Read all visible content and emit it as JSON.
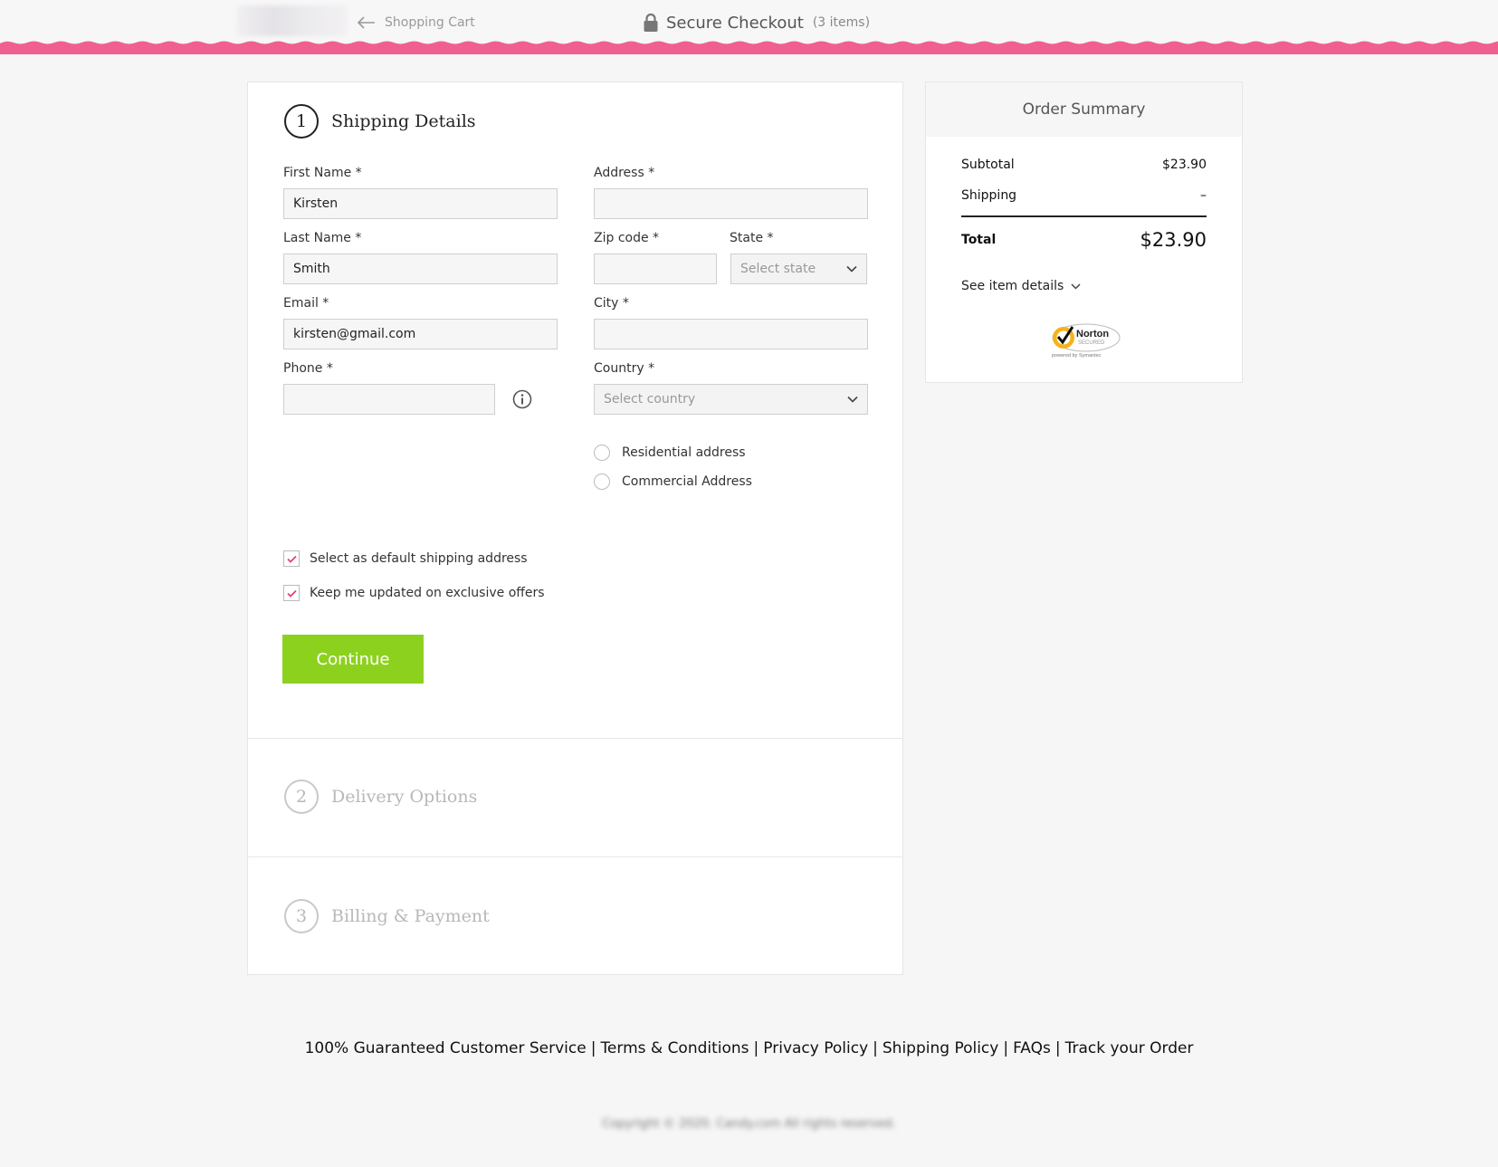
{
  "header": {
    "back_label": "Shopping Cart",
    "title": "Secure Checkout",
    "item_count": "(3 items)"
  },
  "shipping": {
    "step_number": "1",
    "title": "Shipping Details",
    "first_name": {
      "label": "First Name *",
      "value": "Kirsten"
    },
    "last_name": {
      "label": "Last Name *",
      "value": "Smith"
    },
    "email": {
      "label": "Email *",
      "value": "kirsten@gmail.com"
    },
    "phone": {
      "label": "Phone *",
      "value": ""
    },
    "address": {
      "label": "Address *",
      "value": ""
    },
    "zip": {
      "label": "Zip code *",
      "value": ""
    },
    "state": {
      "label": "State *",
      "placeholder": "Select state"
    },
    "city": {
      "label": "City *",
      "value": ""
    },
    "country": {
      "label": "Country *",
      "placeholder": "Select country"
    },
    "address_types": [
      "Residential address",
      "Commercial Address"
    ],
    "default_shipping": {
      "label": "Select as default shipping address",
      "checked": true
    },
    "offers": {
      "label": "Keep me updated on exclusive offers",
      "checked": true
    },
    "continue_label": "Continue"
  },
  "delivery": {
    "step_number": "2",
    "title": "Delivery Options"
  },
  "billing": {
    "step_number": "3",
    "title": "Billing & Payment"
  },
  "summary": {
    "title": "Order Summary",
    "subtotal_label": "Subtotal",
    "subtotal_value": "$23.90",
    "shipping_label": "Shipping",
    "shipping_value": "–",
    "total_label": "Total",
    "total_value": "$23.90",
    "see_details": "See item details",
    "badge_text": "Norton",
    "badge_sub": "SECURED",
    "badge_powered": "powered by Symantec"
  },
  "footer": {
    "links": [
      "100% Guaranteed Customer Service",
      "Terms & Conditions",
      "Privacy Policy",
      "Shipping Policy",
      "FAQs",
      "Track your Order"
    ],
    "copyright": "Copyright © 2020. Candy.com All rights reserved."
  },
  "colors": {
    "accent_pink": "#f0608f",
    "continue_green": "#8dd11f",
    "check_pink": "#e6436f"
  }
}
